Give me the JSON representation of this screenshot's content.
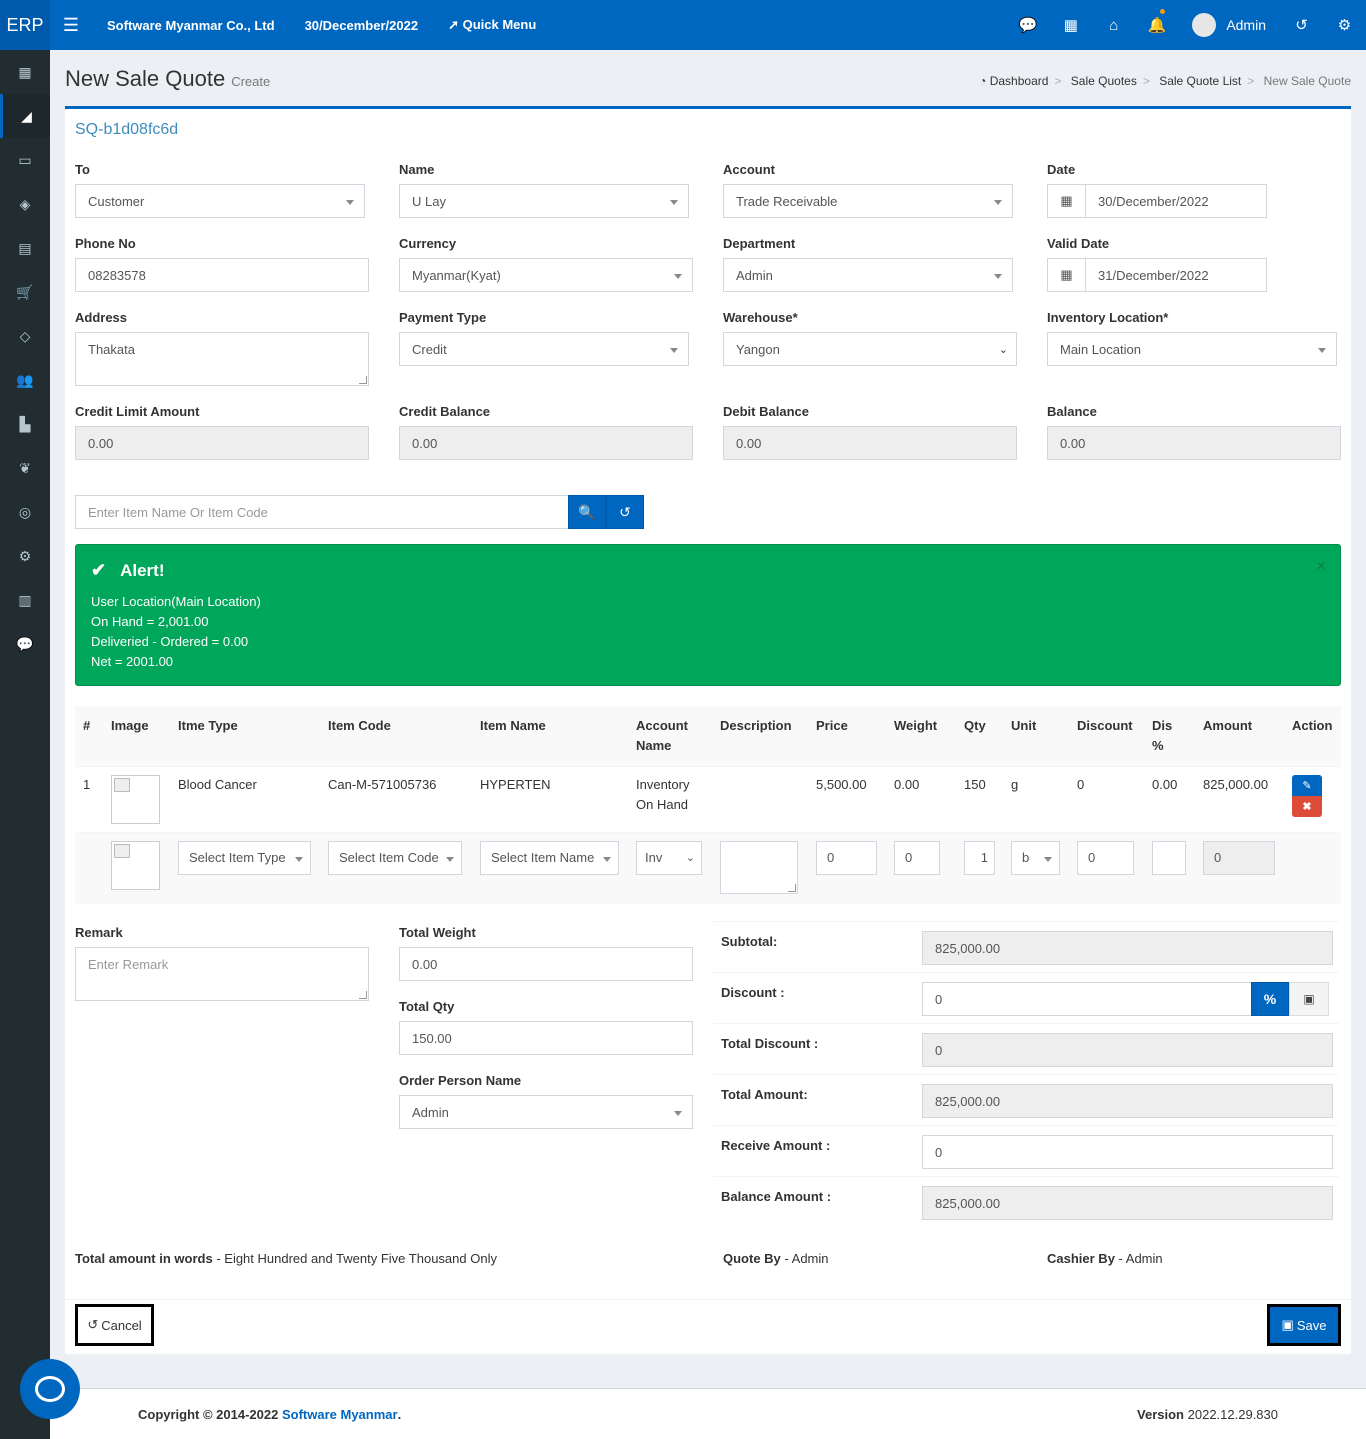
{
  "topbar": {
    "logo": "ERP",
    "company": "Software Myanmar Co., Ltd",
    "date": "30/December/2022",
    "quick_menu": "Quick Menu",
    "user": "Admin"
  },
  "header": {
    "title": "New Sale Quote",
    "subtitle": "Create",
    "breadcrumb": [
      "Dashboard",
      "Sale Quotes",
      "Sale Quote List",
      "New Sale Quote"
    ]
  },
  "quote_no": "SQ-b1d08fc6d",
  "form": {
    "to": {
      "label": "To",
      "value": "Customer"
    },
    "name": {
      "label": "Name",
      "value": "U Lay"
    },
    "account": {
      "label": "Account",
      "value": "Trade Receivable"
    },
    "date": {
      "label": "Date",
      "value": "30/December/2022"
    },
    "phone": {
      "label": "Phone No",
      "value": "08283578"
    },
    "currency": {
      "label": "Currency",
      "value": "Myanmar(Kyat)"
    },
    "department": {
      "label": "Department",
      "value": "Admin"
    },
    "valid_date": {
      "label": "Valid Date",
      "value": "31/December/2022"
    },
    "address": {
      "label": "Address",
      "value": "Thakata"
    },
    "payment_type": {
      "label": "Payment Type",
      "value": "Credit"
    },
    "warehouse": {
      "label": "Warehouse*",
      "value": "Yangon"
    },
    "inventory_location": {
      "label": "Inventory Location*",
      "value": "Main Location"
    },
    "credit_limit": {
      "label": "Credit Limit Amount",
      "value": "0.00"
    },
    "credit_balance": {
      "label": "Credit Balance",
      "value": "0.00"
    },
    "debit_balance": {
      "label": "Debit Balance",
      "value": "0.00"
    },
    "balance": {
      "label": "Balance",
      "value": "0.00"
    }
  },
  "search": {
    "placeholder": "Enter Item Name Or Item Code"
  },
  "alert": {
    "title": "Alert!",
    "lines": [
      "User Location(Main Location)",
      "On Hand = 2,001.00",
      "Deliveried - Ordered = 0.00",
      "Net = 2001.00"
    ],
    "close": "×"
  },
  "table": {
    "headers": [
      "#",
      "Image",
      "Itme Type",
      "Item Code",
      "Item Name",
      "Account Name",
      "Description",
      "Price",
      "Weight",
      "Qty",
      "Unit",
      "Discount",
      "Dis %",
      "Amount",
      "Action"
    ],
    "row": {
      "no": "1",
      "item_type": "Blood Cancer",
      "item_code": "Can-M-571005736",
      "item_name": "HYPERTEN",
      "account_name": "Inventory On Hand",
      "description": "",
      "price": "5,500.00",
      "weight": "0.00",
      "qty": "150",
      "unit": "g",
      "discount": "0",
      "dis_percent": "0.00",
      "amount": "825,000.00"
    },
    "new_row": {
      "item_type": "Select Item Type",
      "item_code": "Select Item Code",
      "item_name": "Select Item Name",
      "account": "Inv",
      "price": "0",
      "weight": "0",
      "qty": "1",
      "unit": "b",
      "discount": "0",
      "dis_percent": "",
      "amount": "0"
    }
  },
  "remark": {
    "label": "Remark",
    "placeholder": "Enter Remark"
  },
  "total_weight": {
    "label": "Total Weight",
    "value": "0.00"
  },
  "total_qty": {
    "label": "Total Qty",
    "value": "150.00"
  },
  "order_person": {
    "label": "Order Person Name",
    "value": "Admin"
  },
  "totals": {
    "subtotal": {
      "label": "Subtotal:",
      "value": "825,000.00"
    },
    "discount": {
      "label": "Discount :",
      "value": "0",
      "percent_btn": "%"
    },
    "total_discount": {
      "label": "Total Discount :",
      "value": "0"
    },
    "total_amount": {
      "label": "Total Amount:",
      "value": "825,000.00"
    },
    "receive_amount": {
      "label": "Receive Amount :",
      "value": "0"
    },
    "balance_amount": {
      "label": "Balance Amount :",
      "value": "825,000.00"
    }
  },
  "summary": {
    "words_label": "Total amount in words",
    "words": "- Eight Hundred and Twenty Five Thousand Only",
    "quote_by_label": "Quote By",
    "quote_by": "- Admin",
    "cashier_by_label": "Cashier By",
    "cashier_by": "- Admin"
  },
  "buttons": {
    "cancel": "Cancel",
    "save": "Save"
  },
  "footer": {
    "copyright": "Copyright © 2014-2022",
    "company": "Software Myanmar",
    "dot": ".",
    "version_label": "Version",
    "version": "2022.12.29.830"
  },
  "colors": {
    "primary": "#0067c0",
    "success": "#00a65a",
    "danger": "#dd4b39",
    "sidebar": "#222d32"
  }
}
